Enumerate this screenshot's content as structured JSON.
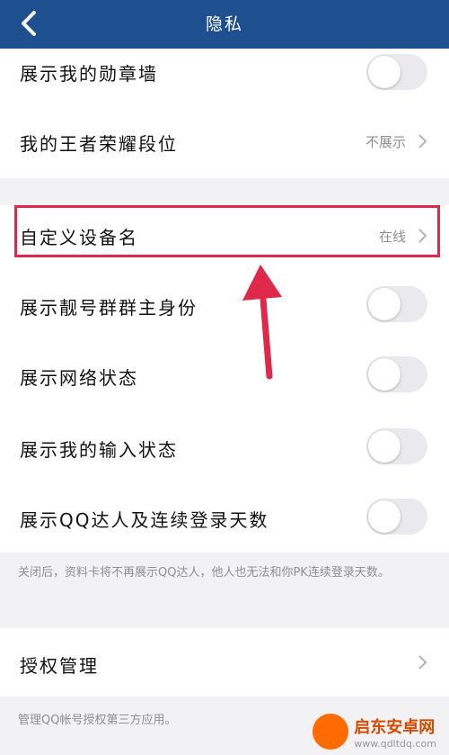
{
  "header": {
    "title": "隐私"
  },
  "rows": {
    "medal": {
      "label": "展示我的勋章墙"
    },
    "king": {
      "label": "我的王者荣耀段位",
      "value": "不展示"
    },
    "device": {
      "label": "自定义设备名",
      "value": "在线"
    },
    "group": {
      "label": "展示靓号群群主身份"
    },
    "network": {
      "label": "展示网络状态"
    },
    "typing": {
      "label": "展示我的输入状态"
    },
    "qqmaster": {
      "label": "展示QQ达人及连续登录天数"
    },
    "auth": {
      "label": "授权管理"
    }
  },
  "notes": {
    "qqmaster": "关闭后，资料卡将不再展示QQ达人，他人也无法和你PK连续登录天数。",
    "auth": "管理QQ帐号授权第三方应用。"
  },
  "watermark": {
    "name": "启东安卓网",
    "url": "www.qdltdq.com"
  },
  "colors": {
    "header": "#1e4f8f",
    "highlight": "#e0284a"
  }
}
